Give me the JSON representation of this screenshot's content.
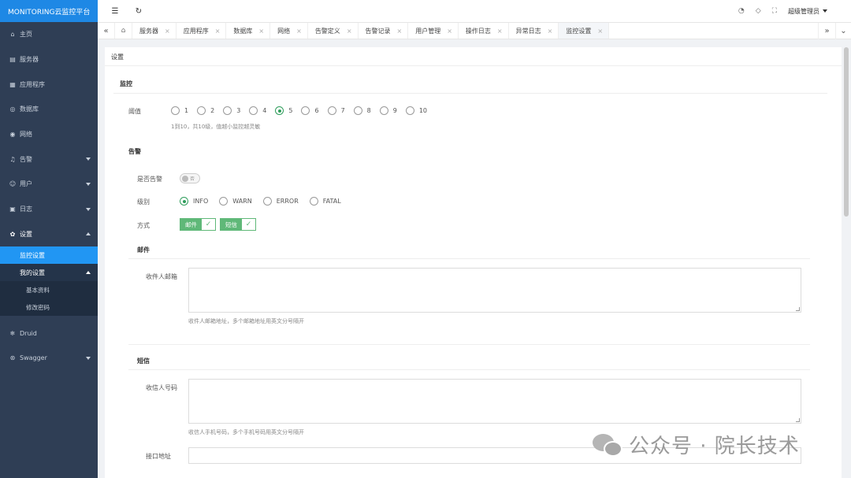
{
  "brand": "MONITORING云监控平台",
  "sidebar": {
    "items": [
      {
        "label": "主页",
        "icon": "home-icon"
      },
      {
        "label": "服务器",
        "icon": "server-icon"
      },
      {
        "label": "应用程序",
        "icon": "app-icon"
      },
      {
        "label": "数据库",
        "icon": "database-icon"
      },
      {
        "label": "网络",
        "icon": "network-icon"
      },
      {
        "label": "告警",
        "icon": "bell-icon"
      },
      {
        "label": "用户",
        "icon": "user-icon"
      },
      {
        "label": "日志",
        "icon": "log-icon"
      },
      {
        "label": "设置",
        "icon": "gear-icon"
      }
    ],
    "settings_sub": {
      "monitor_settings": "监控设置",
      "my_settings": "我的设置",
      "basic_info": "基本资料",
      "change_password": "修改密码"
    },
    "druid": "Druid",
    "swagger": "Swagger"
  },
  "header": {
    "user": "超级管理员"
  },
  "tabs": [
    {
      "label": "服务器"
    },
    {
      "label": "应用程序"
    },
    {
      "label": "数据库"
    },
    {
      "label": "网络"
    },
    {
      "label": "告警定义"
    },
    {
      "label": "告警记录"
    },
    {
      "label": "用户管理"
    },
    {
      "label": "操作日志"
    },
    {
      "label": "异常日志"
    },
    {
      "label": "监控设置"
    }
  ],
  "tab_close": "×",
  "page": {
    "title": "设置",
    "monitor": {
      "section": "监控",
      "threshold_label": "阈值",
      "threshold_options": [
        "1",
        "2",
        "3",
        "4",
        "5",
        "6",
        "7",
        "8",
        "9",
        "10"
      ],
      "threshold_selected": "5",
      "threshold_hint": "1到10，共10级，值越小监控越灵敏"
    },
    "alarm": {
      "section": "告警",
      "enable_label": "是否告警",
      "enable_value": "否",
      "level_label": "级别",
      "level_options": [
        "INFO",
        "WARN",
        "ERROR",
        "FATAL"
      ],
      "level_selected": "INFO",
      "method_label": "方式",
      "method_email": "邮件",
      "method_sms": "短信",
      "check_mark": "✓"
    },
    "email": {
      "section": "邮件",
      "receiver_label": "收件人邮箱",
      "receiver_value": "",
      "receiver_hint": "收件人邮箱地址，多个邮箱地址用英文分号隔开"
    },
    "sms": {
      "section": "短信",
      "receiver_label": "收信人号码",
      "receiver_value": "",
      "receiver_hint": "收信人手机号码，多个手机号码用英文分号隔开",
      "api_label": "接口地址",
      "api_value": ""
    }
  },
  "watermark": "公众号 · 院长技术"
}
